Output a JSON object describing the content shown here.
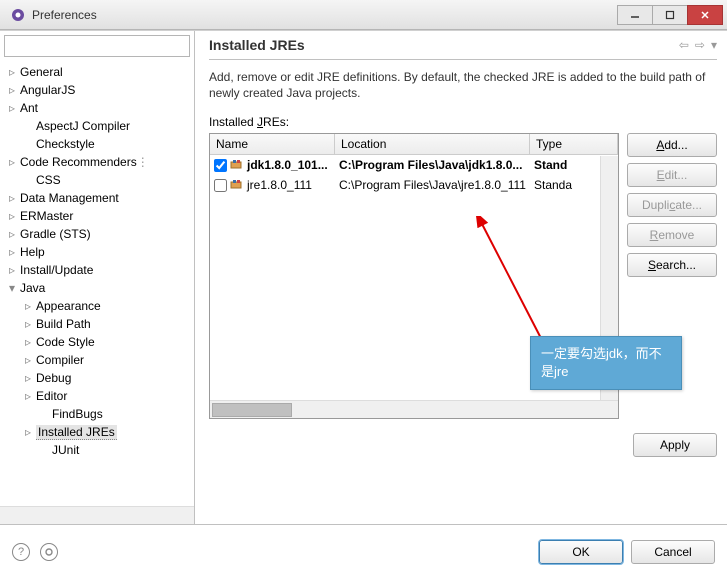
{
  "window": {
    "title": "Preferences"
  },
  "tree": [
    {
      "label": "General",
      "expand": "collapsed",
      "indent": 0
    },
    {
      "label": "AngularJS",
      "expand": "collapsed",
      "indent": 0
    },
    {
      "label": "Ant",
      "expand": "collapsed",
      "indent": 0
    },
    {
      "label": "AspectJ Compiler",
      "expand": "none",
      "indent": 1
    },
    {
      "label": "Checkstyle",
      "expand": "none",
      "indent": 1
    },
    {
      "label": "Code Recommenders",
      "expand": "collapsed",
      "indent": 0,
      "clipped": true
    },
    {
      "label": "CSS",
      "expand": "none",
      "indent": 1
    },
    {
      "label": "Data Management",
      "expand": "collapsed",
      "indent": 0
    },
    {
      "label": "ERMaster",
      "expand": "collapsed",
      "indent": 0
    },
    {
      "label": "Gradle (STS)",
      "expand": "collapsed",
      "indent": 0
    },
    {
      "label": "Help",
      "expand": "collapsed",
      "indent": 0
    },
    {
      "label": "Install/Update",
      "expand": "collapsed",
      "indent": 0
    },
    {
      "label": "Java",
      "expand": "expanded",
      "indent": 0
    },
    {
      "label": "Appearance",
      "expand": "collapsed",
      "indent": 1
    },
    {
      "label": "Build Path",
      "expand": "collapsed",
      "indent": 1
    },
    {
      "label": "Code Style",
      "expand": "collapsed",
      "indent": 1
    },
    {
      "label": "Compiler",
      "expand": "collapsed",
      "indent": 1
    },
    {
      "label": "Debug",
      "expand": "collapsed",
      "indent": 1
    },
    {
      "label": "Editor",
      "expand": "collapsed",
      "indent": 1
    },
    {
      "label": "FindBugs",
      "expand": "none",
      "indent": 2
    },
    {
      "label": "Installed JREs",
      "expand": "collapsed",
      "indent": 1,
      "selected": true
    },
    {
      "label": "JUnit",
      "expand": "none",
      "indent": 2
    }
  ],
  "page": {
    "title": "Installed JREs",
    "description": "Add, remove or edit JRE definitions. By default, the checked JRE is added to the build path of newly created Java projects.",
    "tableLabel": "Installed JREs:",
    "columns": {
      "name": "Name",
      "location": "Location",
      "type": "Type"
    },
    "rows": [
      {
        "checked": true,
        "bold": true,
        "name": "jdk1.8.0_101...",
        "location": "C:\\Program Files\\Java\\jdk1.8.0...",
        "type": "Stand"
      },
      {
        "checked": false,
        "bold": false,
        "name": "jre1.8.0_111",
        "location": "C:\\Program Files\\Java\\jre1.8.0_111",
        "type": "Standa"
      }
    ],
    "buttons": {
      "add": "Add...",
      "edit": "Edit...",
      "duplicate": "Duplicate...",
      "remove": "Remove",
      "search": "Search...",
      "apply": "Apply"
    }
  },
  "dialog": {
    "ok": "OK",
    "cancel": "Cancel"
  },
  "annotation": {
    "text": "一定要勾选jdk，而不是jre"
  }
}
